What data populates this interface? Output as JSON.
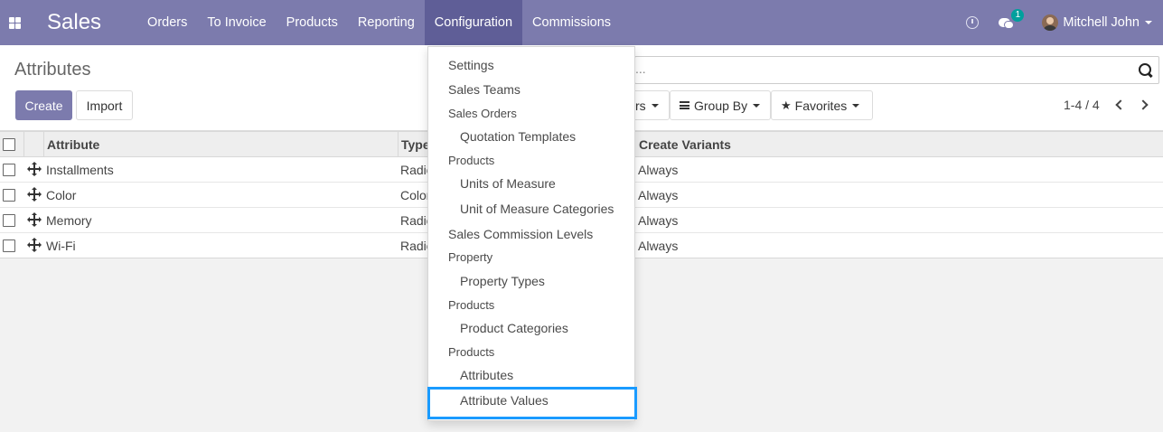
{
  "navbar": {
    "brand": "Sales",
    "menu": [
      "Orders",
      "To Invoice",
      "Products",
      "Reporting",
      "Configuration",
      "Commissions"
    ],
    "active": "Configuration",
    "messages_badge": "1",
    "user_name": "Mitchell John"
  },
  "control": {
    "title": "Attributes",
    "create_label": "Create",
    "import_label": "Import",
    "search_placeholder": "...",
    "filters_label": "rs",
    "groupby_label": "Group By",
    "favorites_label": "Favorites",
    "pager": "1-4 / 4"
  },
  "table": {
    "headers": [
      "Attribute",
      "Type",
      "Create Variants"
    ],
    "rows": [
      {
        "attribute": "Installments",
        "type": "Radio",
        "create_variants": "Always"
      },
      {
        "attribute": "Color",
        "type": "Color",
        "create_variants": "Always"
      },
      {
        "attribute": "Memory",
        "type": "Radio",
        "create_variants": "Always"
      },
      {
        "attribute": "Wi-Fi",
        "type": "Radio",
        "create_variants": "Always"
      }
    ]
  },
  "dropdown": {
    "items": [
      {
        "label": "Settings",
        "kind": "item0"
      },
      {
        "label": "Sales Teams",
        "kind": "item0"
      },
      {
        "label": "Sales Orders",
        "kind": "header"
      },
      {
        "label": "Quotation Templates",
        "kind": "item1"
      },
      {
        "label": "Products",
        "kind": "header"
      },
      {
        "label": "Units of Measure",
        "kind": "item1"
      },
      {
        "label": "Unit of Measure Categories",
        "kind": "item1"
      },
      {
        "label": "Sales Commission Levels",
        "kind": "item0"
      },
      {
        "label": "Property",
        "kind": "header"
      },
      {
        "label": "Property Types",
        "kind": "item1"
      },
      {
        "label": "Products",
        "kind": "header"
      },
      {
        "label": "Product Categories",
        "kind": "item1"
      },
      {
        "label": "Products",
        "kind": "header"
      },
      {
        "label": "Attributes",
        "kind": "item1"
      },
      {
        "label": "Attribute Values",
        "kind": "item1"
      }
    ],
    "highlighted": "Attribute Values"
  },
  "colors": {
    "navbar": "#7c7bad",
    "navbar_active": "#5f5e97",
    "badge": "#00a09d",
    "highlight": "#1a9bff"
  }
}
